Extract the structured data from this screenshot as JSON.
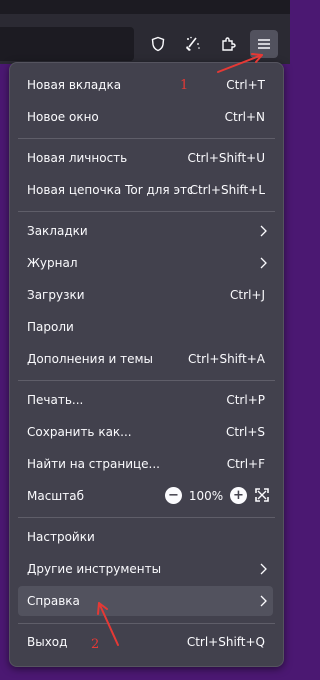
{
  "titlebar": {
    "icons": [
      "chevron-down-icon",
      "minimize-icon",
      "maximize-icon",
      "close-icon"
    ]
  },
  "toolbar": {
    "buttons": [
      "shield-icon",
      "customize-sparkle-icon",
      "extensions-icon",
      "hamburger-menu-icon"
    ]
  },
  "menu": {
    "groups": [
      [
        {
          "label": "Новая вкладка",
          "shortcut": "Ctrl+T"
        },
        {
          "label": "Новое окно",
          "shortcut": "Ctrl+N"
        }
      ],
      [
        {
          "label": "Новая личность",
          "shortcut": "Ctrl+Shift+U"
        },
        {
          "label": "Новая цепочка Tor для этог...",
          "shortcut": "Ctrl+Shift+L"
        }
      ],
      [
        {
          "label": "Закладки",
          "submenu": true
        },
        {
          "label": "Журнал",
          "submenu": true
        },
        {
          "label": "Загрузки",
          "shortcut": "Ctrl+J"
        },
        {
          "label": "Пароли"
        },
        {
          "label": "Дополнения и темы",
          "shortcut": "Ctrl+Shift+A"
        }
      ],
      [
        {
          "label": "Печать...",
          "shortcut": "Ctrl+P"
        },
        {
          "label": "Сохранить как...",
          "shortcut": "Ctrl+S"
        },
        {
          "label": "Найти на странице...",
          "shortcut": "Ctrl+F"
        },
        {
          "label": "Масштаб",
          "zoom": "100%"
        }
      ],
      [
        {
          "label": "Настройки"
        },
        {
          "label": "Другие инструменты",
          "submenu": true
        },
        {
          "label": "Справка",
          "submenu": true,
          "highlighted": true
        }
      ],
      [
        {
          "label": "Выход",
          "shortcut": "Ctrl+Shift+Q"
        }
      ]
    ],
    "zoom": {
      "minus": "−",
      "value": "100%",
      "plus": "+"
    }
  },
  "annotations": {
    "step1": "1",
    "step2": "2",
    "color": "#e53935"
  },
  "colors": {
    "panel": "#42414d",
    "toolbar": "#2b2a33",
    "background": "#4b1872",
    "text": "#fbfbfe"
  }
}
